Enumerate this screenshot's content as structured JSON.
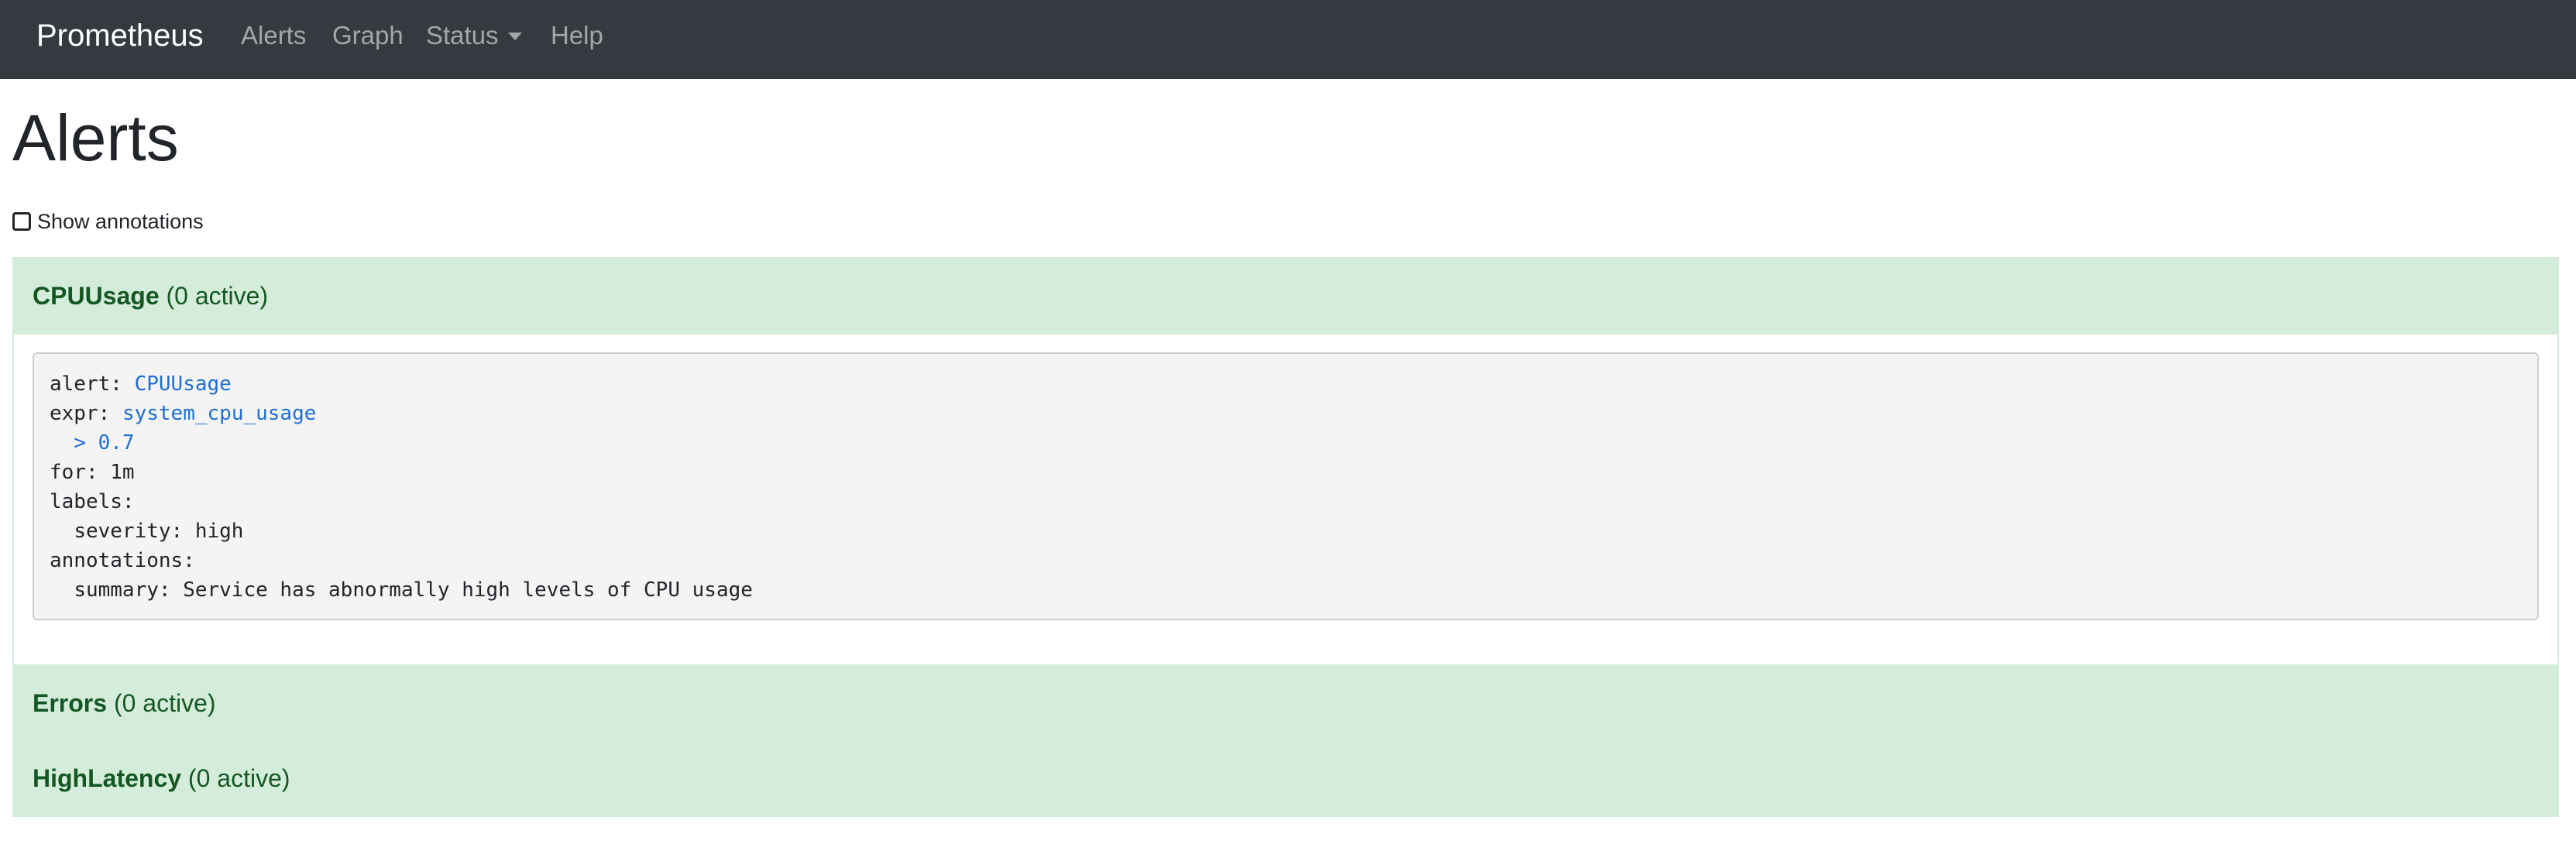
{
  "navbar": {
    "brand": "Prometheus",
    "links": [
      {
        "label": "Alerts"
      },
      {
        "label": "Graph"
      },
      {
        "label": "Status",
        "dropdown": true
      },
      {
        "label": "Help"
      }
    ]
  },
  "page": {
    "title": "Alerts",
    "show_annotations_label": "Show annotations",
    "show_annotations_checked": false
  },
  "rules": [
    {
      "name": "CPUUsage",
      "count_text": "(0 active)",
      "expanded": true,
      "definition": {
        "alert_key": "alert:",
        "alert_value": "CPUUsage",
        "expr_key": "expr:",
        "expr_value": "system_cpu_usage",
        "expr_cont": "> 0.7",
        "for_line": "for: 1m",
        "labels_key": "labels:",
        "severity_line": "severity: high",
        "annotations_key": "annotations:",
        "summary_line": "summary: Service has abnormally high levels of CPU usage"
      }
    },
    {
      "name": "Errors",
      "count_text": "(0 active)",
      "expanded": false
    },
    {
      "name": "HighLatency",
      "count_text": "(0 active)",
      "expanded": false
    }
  ],
  "colors": {
    "navbar_bg": "#343a40",
    "rule_inactive_bg": "#d4edda",
    "rule_inactive_text": "#155724",
    "code_highlight": "#1f6fd1"
  }
}
